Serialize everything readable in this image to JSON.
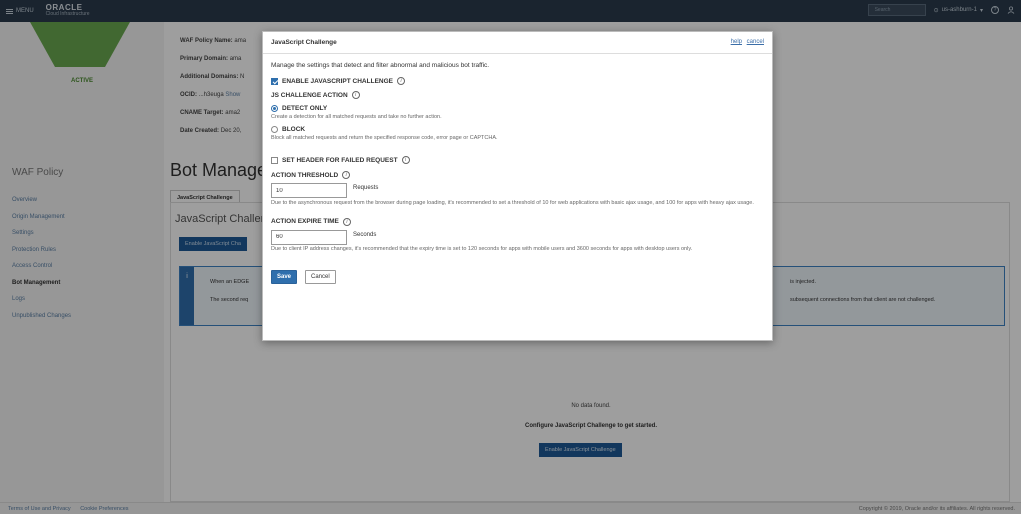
{
  "topbar": {
    "menu_label": "MENU",
    "brand_line1": "ORACLE",
    "brand_line2": "Cloud Infrastructure",
    "search_placeholder": "Search",
    "region": "us-ashburn-1",
    "help_icon": "?",
    "user_icon": "user-icon"
  },
  "left_panel": {
    "status": "ACTIVE",
    "section_title": "WAF Policy",
    "nav": [
      "Overview",
      "Origin Management",
      "Settings",
      "Protection Rules",
      "Access Control",
      "Bot Management",
      "Logs",
      "Unpublished Changes"
    ],
    "active_nav": "Bot Management"
  },
  "info": {
    "policy_name_label": "WAF Policy Name:",
    "policy_name_value": "ama",
    "primary_domain_label": "Primary Domain:",
    "primary_domain_value": "ama",
    "additional_domains_label": "Additional Domains:",
    "additional_domains_value": "N",
    "ocid_label": "OCID:",
    "ocid_value": "...h3euga",
    "ocid_link": "Show",
    "cname_label": "CNAME Target:",
    "cname_value": "ama2",
    "date_label": "Date Created:",
    "date_value": "Dec 20,"
  },
  "main": {
    "title": "Bot Manage",
    "tab": "JavaScript Challenge",
    "section_title": "JavaScript Challen",
    "enable_top_button": "Enable JavaScript Cha",
    "alert_icon": "i",
    "alert_line1": "When an EDGE",
    "alert_line2": "The second req",
    "alert_right1": "is injected.",
    "alert_right2": "subsequent connections from that client are not challenged.",
    "no_data": "No data found.",
    "configure": "Configure JavaScript Challenge to get started.",
    "enable_bottom_button": "Enable JavaScript Challenge"
  },
  "footer": {
    "terms": "Terms of Use and Privacy",
    "cookies": "Cookie Preferences",
    "copyright": "Copyright © 2019, Oracle and/or its affiliates. All rights reserved."
  },
  "dialog": {
    "title": "JavaScript Challenge",
    "help_link": "help",
    "cancel_link": "cancel",
    "description": "Manage the settings that detect and filter abnormal and malicious bot traffic.",
    "enable_label": "ENABLE JAVASCRIPT CHALLENGE",
    "enable_checked": true,
    "action_label": "JS CHALLENGE ACTION",
    "detect_label": "DETECT ONLY",
    "detect_desc": "Create a detection for all matched requests and take no further action.",
    "block_label": "BLOCK",
    "block_desc": "Block all matched requests and return the specified response code, error page or CAPTCHA.",
    "selected_action": "DETECT ONLY",
    "set_header_label": "SET HEADER FOR FAILED REQUEST",
    "set_header_checked": false,
    "threshold_label": "ACTION THRESHOLD",
    "threshold_value": "10",
    "threshold_unit": "Requests",
    "threshold_desc": "Due to the asynchronous request from the browser during page loading, it's recommended to set a threshold of 10 for web applications with basic ajax usage, and 100 for apps with heavy ajax usage.",
    "expire_label": "ACTION EXPIRE TIME",
    "expire_value": "60",
    "expire_unit": "Seconds",
    "expire_desc": "Due to client IP address changes, it's recommended that the expiry time is set to 120 seconds for apps with mobile users and 3600 seconds for apps with desktop users only.",
    "info_glyph": "i",
    "save_button": "Save",
    "cancel_button": "Cancel"
  }
}
